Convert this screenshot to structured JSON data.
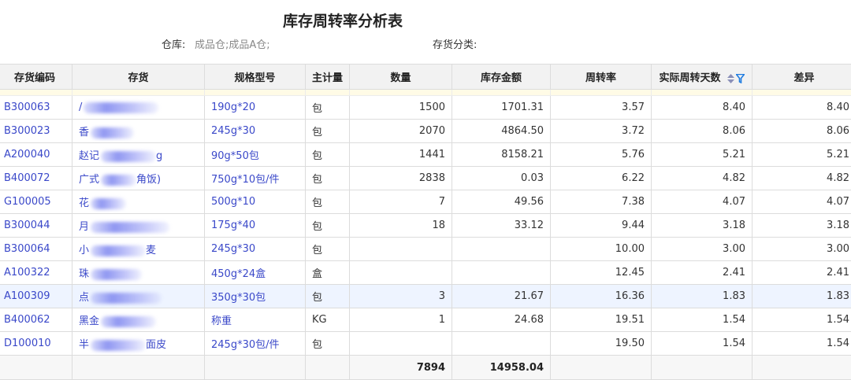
{
  "title": "库存周转率分析表",
  "filters": {
    "warehouse_label": "仓库:",
    "warehouse_value": "成品仓;成品A仓;",
    "category_label": "存货分类:"
  },
  "columns": [
    "存货编码",
    "存货",
    "规格型号",
    "主计量",
    "数量",
    "库存金额",
    "周转率",
    "实际周转天数",
    "差异"
  ],
  "rows": [
    {
      "code": "B300063",
      "name": "/",
      "spec": "190g*20",
      "unit": "包",
      "qty": "1500",
      "amount": "1701.31",
      "rate": "3.57",
      "days": "8.40",
      "diff": "8.40"
    },
    {
      "code": "B300023",
      "name": "香",
      "spec": "245g*30",
      "unit": "包",
      "qty": "2070",
      "amount": "4864.50",
      "rate": "3.72",
      "days": "8.06",
      "diff": "8.06"
    },
    {
      "code": "A200040",
      "name": "赵记",
      "name_tail": "g",
      "spec": "90g*50包",
      "unit": "包",
      "qty": "1441",
      "amount": "8158.21",
      "rate": "5.76",
      "days": "5.21",
      "diff": "5.21"
    },
    {
      "code": "B400072",
      "name": "广式",
      "name_tail": "角饭)",
      "spec": "750g*10包/件",
      "unit": "包",
      "qty": "2838",
      "amount": "0.03",
      "rate": "6.22",
      "days": "4.82",
      "diff": "4.82"
    },
    {
      "code": "G100005",
      "name": "花",
      "spec": "500g*10",
      "unit": "包",
      "qty": "7",
      "amount": "49.56",
      "rate": "7.38",
      "days": "4.07",
      "diff": "4.07"
    },
    {
      "code": "B300044",
      "name": "月",
      "spec": "175g*40",
      "unit": "包",
      "qty": "18",
      "amount": "33.12",
      "rate": "9.44",
      "days": "3.18",
      "diff": "3.18"
    },
    {
      "code": "B300064",
      "name": "小",
      "name_tail": "麦",
      "spec": "245g*30",
      "unit": "包",
      "qty": "",
      "amount": "",
      "rate": "10.00",
      "days": "3.00",
      "diff": "3.00"
    },
    {
      "code": "A100322",
      "name": "珠",
      "spec": "450g*24盒",
      "unit": "盒",
      "qty": "",
      "amount": "",
      "rate": "12.45",
      "days": "2.41",
      "diff": "2.41"
    },
    {
      "code": "A100309",
      "name": "点",
      "spec": "350g*30包",
      "unit": "包",
      "qty": "3",
      "amount": "21.67",
      "rate": "16.36",
      "days": "1.83",
      "diff": "1.83",
      "highlight": true
    },
    {
      "code": "B400062",
      "name": "黑金",
      "spec": "称重",
      "unit": "KG",
      "qty": "1",
      "amount": "24.68",
      "rate": "19.51",
      "days": "1.54",
      "diff": "1.54"
    },
    {
      "code": "D100010",
      "name": "半",
      "name_tail": "面皮",
      "spec": "245g*30包/件",
      "unit": "包",
      "qty": "",
      "amount": "",
      "rate": "19.50",
      "days": "1.54",
      "diff": "1.54"
    }
  ],
  "totals": {
    "qty": "7894",
    "amount": "14958.04"
  },
  "colors": {
    "link": "#3a48c9",
    "header_bg": "#f2f2f2",
    "highlight_row": "#eef4ff",
    "filter_icon": "#1e7be0"
  },
  "icons": {
    "sort": "sort-updown-icon",
    "filter": "filter-icon"
  }
}
